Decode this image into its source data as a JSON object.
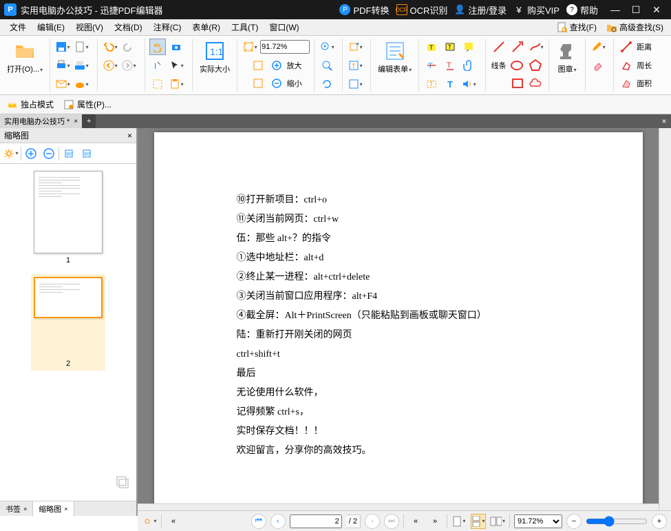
{
  "titlebar": {
    "doc_title": "实用电脑办公技巧",
    "app_name": "迅捷PDF编辑器",
    "sep": " - ",
    "pdf_convert": "PDF转换",
    "ocr": "OCR识别",
    "login": "注册/登录",
    "vip": "购买VIP",
    "help": "帮助"
  },
  "menubar": {
    "file": "文件",
    "edit": "编辑(E)",
    "view": "视图(V)",
    "doc": "文档(D)",
    "comment": "注释(C)",
    "form": "表单(R)",
    "tools": "工具(T)",
    "window": "窗口(W)",
    "find": "查找(F)",
    "advfind": "高级查找(S)"
  },
  "toolbar": {
    "open": "打开(O)...",
    "zoom_value": "91.72%",
    "actual_size": "实际大小",
    "zoom_in": "放大",
    "zoom_out": "缩小",
    "edit_form": "编辑表单",
    "line": "线条",
    "stamp": "图章",
    "distance": "距离",
    "perimeter": "周长",
    "area": "面积"
  },
  "subbar": {
    "exclusive": "独占模式",
    "props": "属性(P)..."
  },
  "doctab": {
    "name": "实用电脑办公技巧 *"
  },
  "sidepanel": {
    "title": "缩略图",
    "page1": "1",
    "page2": "2"
  },
  "bottom_tabs": {
    "bookmark": "书签",
    "thumbs": "缩略图"
  },
  "document": {
    "l1": "⑩打开新项目：ctrl+o",
    "l2": "⑪关闭当前网页：ctrl+w",
    "l3": "伍：那些 alt+？的指令",
    "l4": "①选中地址栏：alt+d",
    "l5": "②终止某一进程：alt+ctrl+delete",
    "l6": "③关闭当前窗口应用程序：alt+F4",
    "l7": "④截全屏：Alt＋PrintScreen（只能粘贴到画板或聊天窗口）",
    "l8": "陆：重新打开刚关闭的网页",
    "l9": "ctrl+shift+t",
    "l10": "最后",
    "l11": "无论使用什么软件，",
    "l12": "记得频繁 ctrl+s，",
    "l13": "实时保存文档！！！",
    "l14": "欢迎留言，分享你的高效技巧。"
  },
  "statusbar": {
    "current_page": "2",
    "total_pages": "/ 2",
    "zoom": "91.72%"
  }
}
